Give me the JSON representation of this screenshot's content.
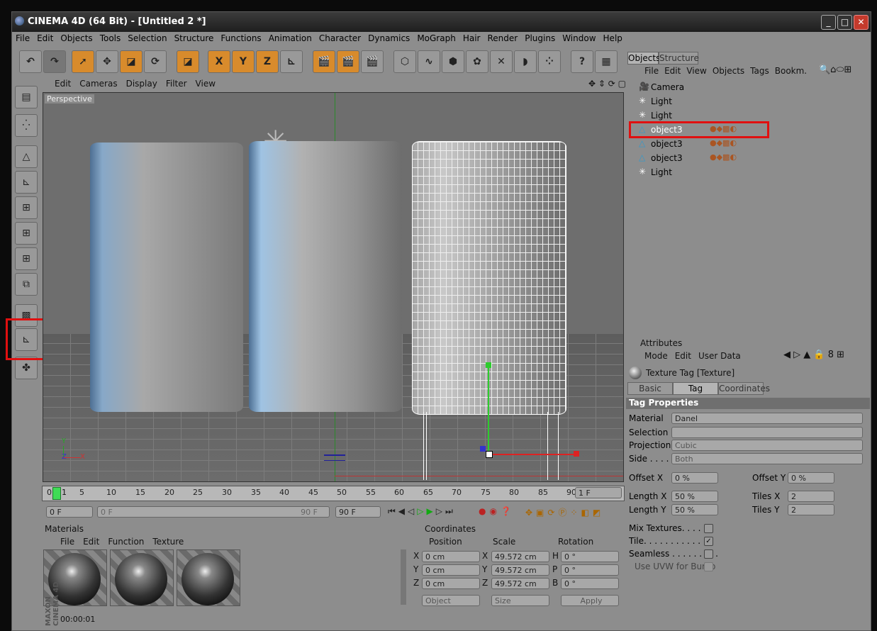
{
  "window": {
    "title": "CINEMA 4D (64 Bit) - [Untitled 2 *]",
    "min": "_",
    "max": "□",
    "close": "✕"
  },
  "menu": [
    "File",
    "Edit",
    "Objects",
    "Tools",
    "Selection",
    "Structure",
    "Functions",
    "Animation",
    "Character",
    "Dynamics",
    "MoGraph",
    "Hair",
    "Render",
    "Plugins",
    "Window",
    "Help"
  ],
  "toolbar": {
    "x": "X",
    "y": "Y",
    "z": "Z"
  },
  "viewport": {
    "menu": [
      "Edit",
      "Cameras",
      "Display",
      "Filter",
      "View"
    ],
    "label": "Perspective",
    "axis_y": "Y",
    "axis_z": "Z",
    "axis_x": "X"
  },
  "timeline": {
    "ticks": [
      "0",
      "5",
      "10",
      "15",
      "20",
      "25",
      "30",
      "35",
      "40",
      "45",
      "50",
      "55",
      "60",
      "65",
      "70",
      "75",
      "80",
      "85",
      "90"
    ],
    "current": "1",
    "frame_field": "1 F",
    "start": "0 F",
    "range_start": "0 F",
    "range_end": "90 F",
    "end": "90 F"
  },
  "materials": {
    "title": "Materials",
    "menu": [
      "File",
      "Edit",
      "Function",
      "Texture"
    ],
    "time": "00:00:01",
    "brand": "MAXON CINEMA 4D"
  },
  "coordinates": {
    "title": "Coordinates",
    "headers": [
      "Position",
      "Scale",
      "Rotation"
    ],
    "rows": [
      {
        "axis": "X",
        "pos": "0 cm",
        "saxis": "X",
        "scale": "49.572 cm",
        "raxis": "H",
        "rot": "0 °"
      },
      {
        "axis": "Y",
        "pos": "0 cm",
        "saxis": "Y",
        "scale": "49.572 cm",
        "raxis": "P",
        "rot": "0 °"
      },
      {
        "axis": "Z",
        "pos": "0 cm",
        "saxis": "Z",
        "scale": "49.572 cm",
        "raxis": "B",
        "rot": "0 °"
      }
    ],
    "mode": "Object",
    "size": "Size",
    "apply": "Apply"
  },
  "objects": {
    "tabs": [
      "Objects",
      "Structure"
    ],
    "menu": [
      "File",
      "Edit",
      "View",
      "Objects",
      "Tags",
      "Bookm."
    ],
    "items": [
      {
        "name": "Camera"
      },
      {
        "name": "Light"
      },
      {
        "name": "Light"
      },
      {
        "name": "object3"
      },
      {
        "name": "object3"
      },
      {
        "name": "object3"
      },
      {
        "name": "Light"
      }
    ]
  },
  "attributes": {
    "title": "Attributes",
    "menu": [
      "Mode",
      "Edit",
      "User Data"
    ],
    "object": "Texture Tag [Texture]",
    "tabs": [
      "Basic",
      "Tag",
      "Coordinates"
    ],
    "section": "Tag Properties",
    "material_label": "Material",
    "material": "Danel",
    "selection_label": "Selection",
    "projection_label": "Projection",
    "projection": "Cubic",
    "side_label": "Side . . . .",
    "side": "Both",
    "offsetx_label": "Offset X",
    "offsetx": "0 %",
    "offsety_label": "Offset Y",
    "offsety": "0 %",
    "lengthx_label": "Length X",
    "lengthx": "50 %",
    "tilesx_label": "Tiles X",
    "tilesx": "2",
    "lengthy_label": "Length Y",
    "lengthy": "50 %",
    "tilesy_label": "Tiles Y",
    "tilesy": "2",
    "mix_label": "Mix Textures. . . . . .",
    "tile_label": "Tile. . . . . . . . . . . . .",
    "seamless_label": "Seamless . . . . . . . . .",
    "uvw_label": "Use UVW for Bump"
  },
  "colors": {
    "accent": "#d88b2c",
    "highlight": "#e01010"
  }
}
